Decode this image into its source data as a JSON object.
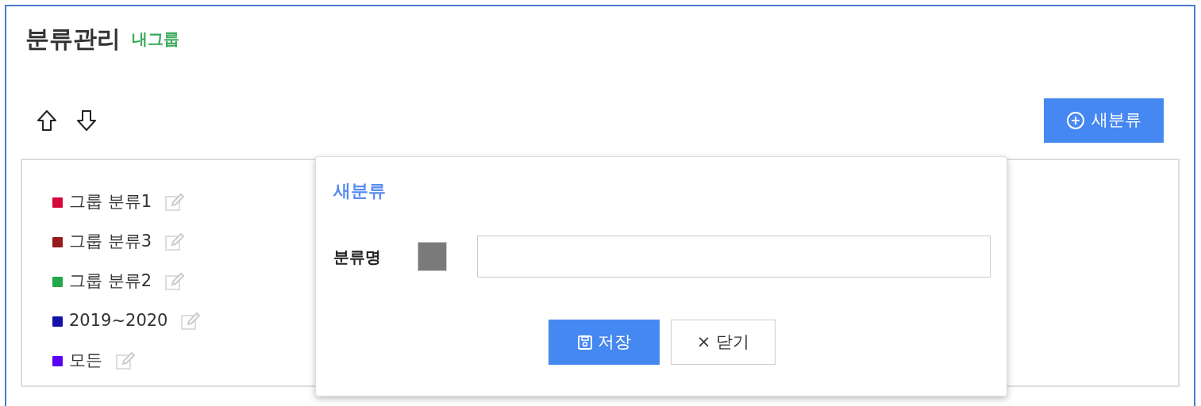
{
  "header": {
    "title": "분류관리",
    "subtitle": "내그룹"
  },
  "toolbar": {
    "new_button": "새분류"
  },
  "categories": [
    {
      "label": "그룹 분류1",
      "color": "#d6083a"
    },
    {
      "label": "그룹 분류3",
      "color": "#951a1d"
    },
    {
      "label": "그룹 분류2",
      "color": "#22a74a"
    },
    {
      "label": "2019~2020",
      "color": "#1410a8"
    },
    {
      "label": "모든",
      "color": "#5a00f5"
    }
  ],
  "dialog": {
    "title": "새분류",
    "field_label": "분류명",
    "color": "#7a7a7a",
    "save_button": "저장",
    "close_button": "닫기",
    "close_glyph": "×"
  }
}
